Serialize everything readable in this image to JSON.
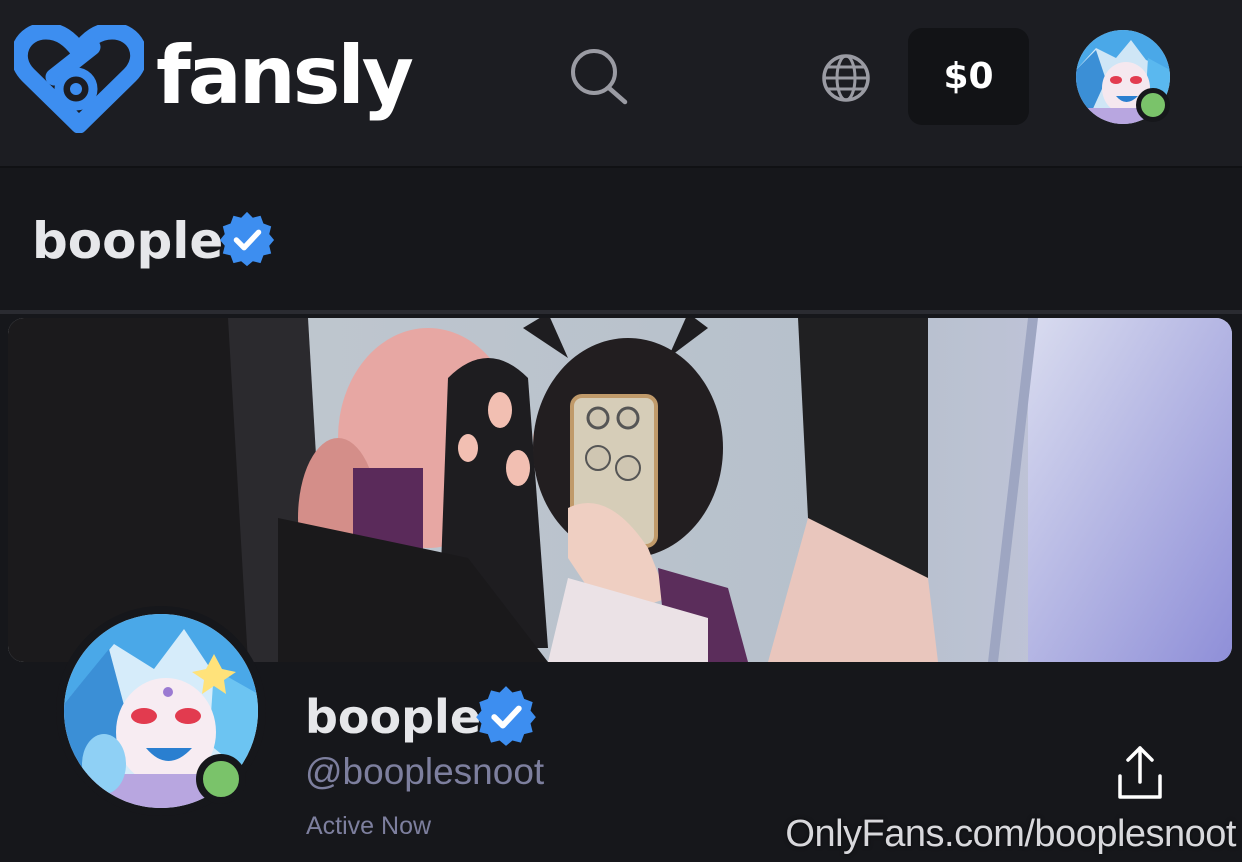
{
  "header": {
    "brand": "fansly",
    "wallet_balance": "$0",
    "icons": {
      "logo": "fansly-heart-logo-icon",
      "search": "search-icon",
      "language": "globe-icon",
      "avatar": "user-avatar"
    },
    "accent_color": "#3d8ef0",
    "online_color": "#7ac36a"
  },
  "page": {
    "title": "boople",
    "verified_icon": "verified-badge-icon"
  },
  "profile": {
    "display_name": "boople",
    "handle": "@booplesnoot",
    "status": "Active Now",
    "share_icon": "share-icon"
  },
  "overlay": {
    "watermark": "OnlyFans.com/booplesnoot"
  }
}
